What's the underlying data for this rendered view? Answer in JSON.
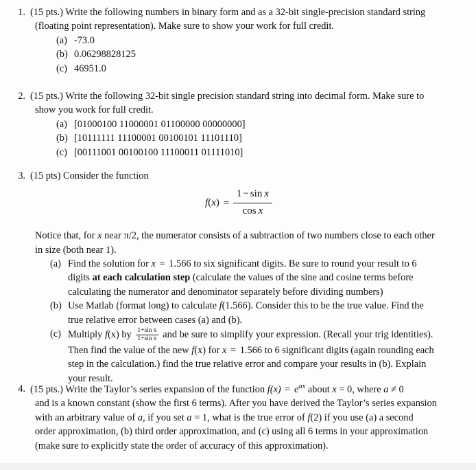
{
  "document": {
    "type": "homework-assignment",
    "background_color": "#fdfdfd",
    "text_color": "#121212"
  },
  "problems": [
    {
      "number": "1.",
      "points": "(15 pts.)",
      "intro_line_1": "(15 pts.) Write the following numbers in binary form and as a 32-bit single-precision standard string",
      "intro_line_2": "(floating point representation).  Make sure to show your work for full credit.",
      "items": [
        {
          "label": "(a)",
          "text": "-73.0"
        },
        {
          "label": "(b)",
          "text": "0.06298828125"
        },
        {
          "label": "(c)",
          "text": "46951.0"
        }
      ]
    },
    {
      "number": "2.",
      "points": "(15 pts.)",
      "intro_line_1": "(15 pts.) Write the following 32-bit single precision standard string into decimal form.  Make sure to",
      "intro_line_2": "show you work for full credit.",
      "items": [
        {
          "label": "(a)",
          "text": "[01000100 11000001 01100000 00000000]"
        },
        {
          "label": "(b)",
          "text": "[10111111 11100001 00100101 11101110]"
        },
        {
          "label": "(c)",
          "text": "[00111001 00100100 11100011 01111010]"
        }
      ]
    },
    {
      "number": "3.",
      "points": "(15 pts)",
      "intro_line_1": "(15 pts) Consider the function",
      "equation": {
        "lhs": "f",
        "lhs_arg_open": "(",
        "lhs_var": "x",
        "lhs_arg_close": ")",
        "equals": "=",
        "numerator_one": "1",
        "numerator_minus": "−",
        "numerator_sin": "sin",
        "numerator_var": "x",
        "denominator_cos": "cos",
        "denominator_var": "x"
      },
      "note_line_1_a": "Notice that, for ",
      "note_line_1_var": "x",
      "note_line_1_b": " near ",
      "note_line_1_pi": "π/2",
      "note_line_1_c": ", the numerator consists of a subtraction of two numbers close to each other",
      "note_line_2": "in size (both near 1).",
      "items": [
        {
          "label": "(a)",
          "line_1_a": "Find the solution for ",
          "line_1_var": "x",
          "line_1_eq": " = ",
          "line_1_val": "1.566",
          "line_1_b": " to six significant digits.  Be sure to round your result to 6",
          "line_2_a": "digits ",
          "line_2_bold": "at each calculation step",
          "line_2_b": " (calculate the values of the sine and cosine terms before",
          "line_3": "calculating the numerator and denominator separately before dividing numbers)"
        },
        {
          "label": "(b)",
          "line_1_a": "Use Matlab (format long) to calculate ",
          "line_1_f": "f",
          "line_1_arg": "(1.566)",
          "line_1_b": ".  Consider this to be the true value.  Find the",
          "line_2": "true relative error between cases (a) and (b)."
        },
        {
          "label": "(c)",
          "line_1_a": "Multiply ",
          "line_1_f": "f",
          "line_1_fx": "(x)",
          "line_1_b": " by ",
          "frac_num": "1+sin x",
          "frac_den": "1+sin x",
          "line_1_c": " and be sure to simplify your expression. (Recall your trig identities).",
          "line_2_a": "Then find the value of the new ",
          "line_2_f": "f",
          "line_2_fx": "(x)",
          "line_2_b": " for ",
          "line_2_var": "x",
          "line_2_eq": " = ",
          "line_2_val": "1.566",
          "line_2_c": " to 6 significant digits (again rounding each",
          "line_3": "step in the calculation.)  find the true relative error and compare your results in (b).  Explain",
          "line_4": "your result."
        }
      ]
    },
    {
      "number": "4.",
      "points": "(15 pts.)",
      "line_1_a": "(15 pts.) Write the Taylor’s series expansion of the function ",
      "line_1_f": "f",
      "line_1_fx": "(x)",
      "line_1_eq": " = ",
      "line_1_e": "e",
      "line_1_exp": "ax",
      "line_1_b": " about ",
      "line_1_x": "x",
      "line_1_x_eq": " = 0",
      "line_1_c": ", where ",
      "line_1_a_var": "a",
      "line_1_neq": " ≠ 0",
      "line_2_a": "and is a known constant (show the first 6 terms).  After you have derived the Taylor’s series expansion",
      "line_3_a": "with an arbitrary value of ",
      "line_3_a_var": "a",
      "line_3_b": ", if  you set ",
      "line_3_a_var2": "a",
      "line_3_eq": " = 1",
      "line_3_c": ", what is the true error of ",
      "line_3_f": "f",
      "line_3_f2": "(2)",
      "line_3_d": " if you use (a) a second",
      "line_4": "order approximation, (b) third order approximation, and (c) using all 6 terms in your approximation",
      "line_5": "(make sure to explicitly state the order of accuracy of this approximation)."
    }
  ]
}
